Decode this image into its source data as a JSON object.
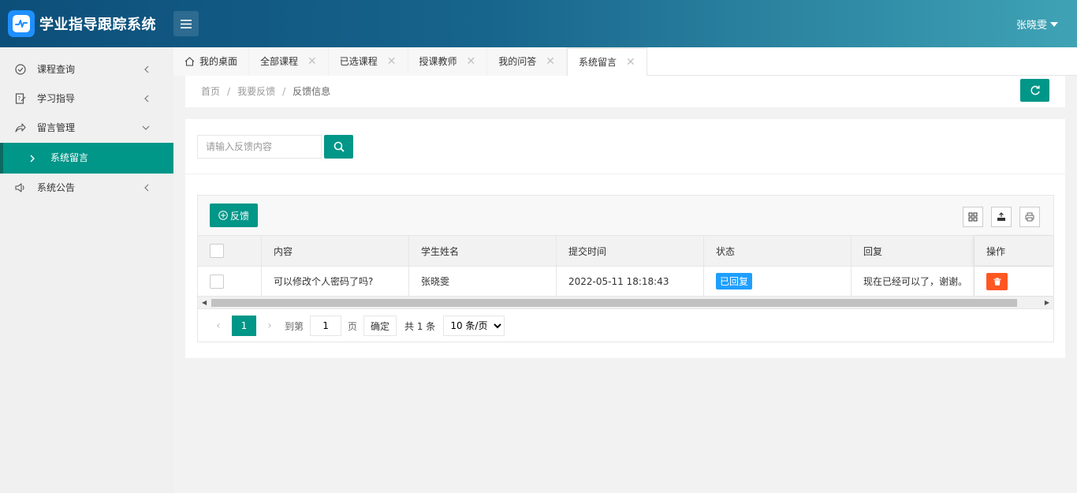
{
  "header": {
    "app_title": "学业指导跟踪系统",
    "user_name": "张晓雯"
  },
  "sidebar": {
    "items": [
      {
        "label": "课程查询",
        "icon": "check-circle-icon"
      },
      {
        "label": "学习指导",
        "icon": "edit-note-icon"
      },
      {
        "label": "留言管理",
        "icon": "share-arrow-icon"
      },
      {
        "label": "系统留言"
      },
      {
        "label": "系统公告",
        "icon": "speaker-icon"
      }
    ]
  },
  "tabs": [
    {
      "label": "我的桌面"
    },
    {
      "label": "全部课程"
    },
    {
      "label": "已选课程"
    },
    {
      "label": "授课教师"
    },
    {
      "label": "我的问答"
    },
    {
      "label": "系统留言"
    }
  ],
  "breadcrumb": {
    "home": "首页",
    "parent": "我要反馈",
    "current": "反馈信息"
  },
  "search": {
    "placeholder": "请输入反馈内容",
    "value": ""
  },
  "toolbar": {
    "add_label": "反馈"
  },
  "table": {
    "columns": [
      "内容",
      "学生姓名",
      "提交时间",
      "状态",
      "回复",
      "操作"
    ],
    "rows": [
      {
        "content": "可以修改个人密码了吗?",
        "student": "张晓雯",
        "time": "2022-05-11 18:18:43",
        "status": "已回复",
        "reply": "现在已经可以了，谢谢。"
      }
    ]
  },
  "pager": {
    "current_page": "1",
    "goto_label": "到第",
    "goto_value": "1",
    "page_unit": "页",
    "confirm_label": "确定",
    "total_label": "共 1 条",
    "page_size": "10 条/页"
  },
  "colors": {
    "primary": "#009688",
    "status_blue": "#1e9fff",
    "danger": "#ff5722"
  }
}
